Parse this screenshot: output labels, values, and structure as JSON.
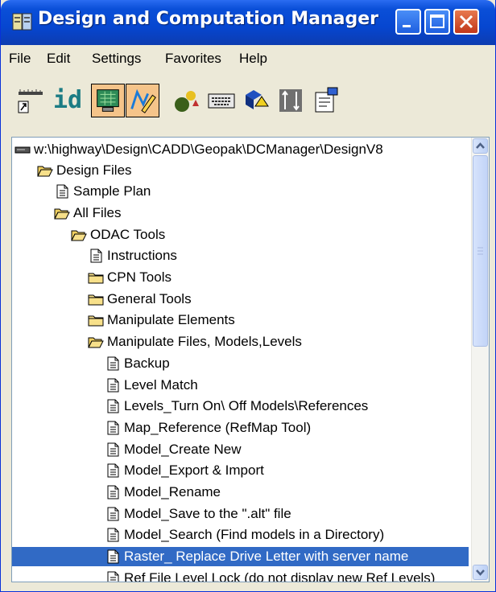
{
  "window": {
    "title": "Design and Computation Manager"
  },
  "menu": [
    "File",
    "Edit",
    "Settings",
    "Favorites",
    "Help"
  ],
  "toolbar": {
    "icons": [
      "ruler-icon",
      "id-icon",
      "monitor-icon",
      "pencil-icon",
      "shapes-icon",
      "keyboard-icon",
      "cubes-icon",
      "grid-arrows-icon",
      "properties-icon"
    ],
    "id_label": "id",
    "pressed": [
      "monitor-icon",
      "pencil-icon"
    ]
  },
  "tree": {
    "root": "w:\\highway\\Design\\CADD\\Geopak\\DCManager\\DesignV8",
    "items": [
      {
        "label": "Design Files",
        "icon": "folder-open-icon"
      },
      {
        "label": "Sample Plan",
        "icon": "document-icon"
      },
      {
        "label": "All Files",
        "icon": "folder-open-icon"
      },
      {
        "label": "ODAC Tools",
        "icon": "folder-open-icon"
      },
      {
        "label": "Instructions",
        "icon": "document-icon"
      },
      {
        "label": "CPN Tools",
        "icon": "folder-icon"
      },
      {
        "label": "General Tools",
        "icon": "folder-icon"
      },
      {
        "label": "Manipulate Elements",
        "icon": "folder-icon"
      },
      {
        "label": "Manipulate Files, Models,Levels",
        "icon": "folder-open-icon"
      },
      {
        "label": "Backup",
        "icon": "document-icon"
      },
      {
        "label": "Level Match",
        "icon": "document-icon"
      },
      {
        "label": "Levels_Turn On\\ Off Models\\References",
        "icon": "document-icon"
      },
      {
        "label": "Map_Reference (RefMap Tool)",
        "icon": "document-icon"
      },
      {
        "label": "Model_Create New",
        "icon": "document-icon"
      },
      {
        "label": "Model_Export & Import",
        "icon": "document-icon"
      },
      {
        "label": "Model_Rename",
        "icon": "document-icon"
      },
      {
        "label": "Model_Save to the \".alt\" file",
        "icon": "document-icon"
      },
      {
        "label": "Model_Search (Find models in a Directory)",
        "icon": "document-icon"
      },
      {
        "label": "Raster_ Replace Drive Letter with server name",
        "icon": "document-icon",
        "selected": true
      },
      {
        "label": "Ref File Level Lock (do not display new Ref Levels)",
        "icon": "document-icon"
      }
    ]
  },
  "colors": {
    "selection": "#316ac5",
    "titlebar": "#0646d0",
    "window_bg": "#ece9d8"
  }
}
